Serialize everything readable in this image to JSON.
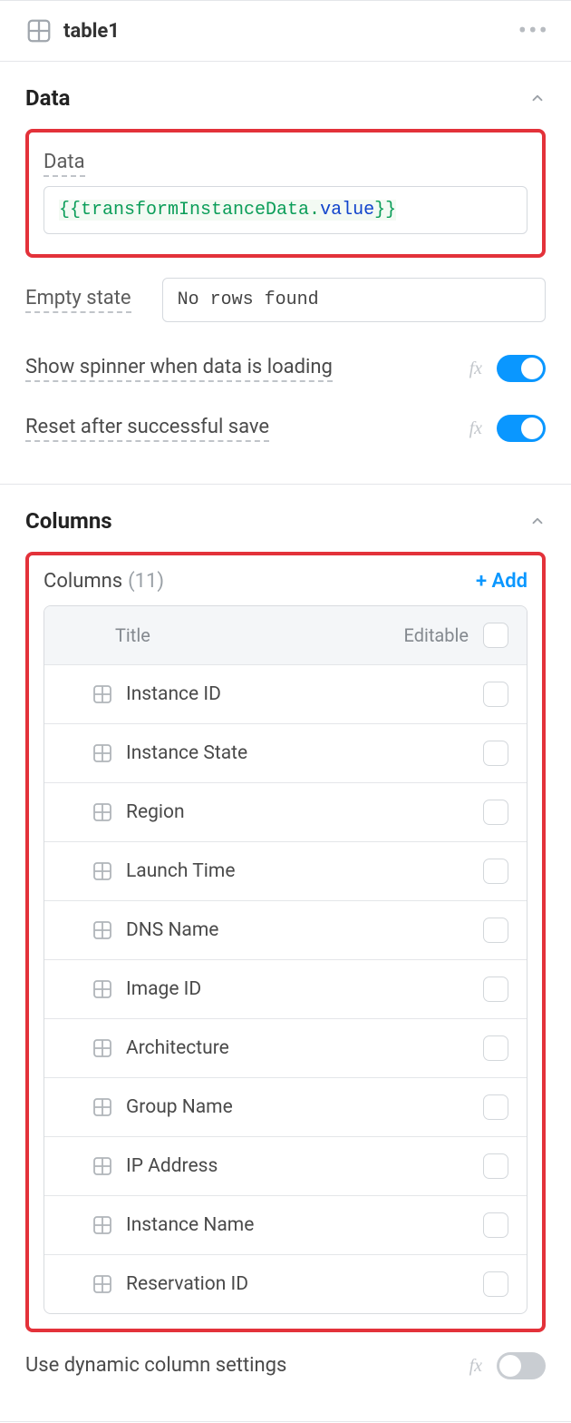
{
  "header": {
    "component_name": "table1"
  },
  "sections": {
    "data": {
      "title": "Data",
      "data_field_label": "Data",
      "data_expression_open": "{{",
      "data_expression_ident": "transformInstanceData.",
      "data_expression_prop": "value",
      "data_expression_close": "}}",
      "empty_state_label": "Empty state",
      "empty_state_value": "No rows found",
      "spinner_label": "Show spinner when data is loading",
      "spinner_on": true,
      "reset_label": "Reset after successful save",
      "reset_on": true
    },
    "columns": {
      "title": "Columns",
      "list_label": "Columns",
      "count_text": "(11)",
      "add_label": "+ Add",
      "header_title": "Title",
      "header_editable": "Editable",
      "items": [
        {
          "title": "Instance ID",
          "editable": false
        },
        {
          "title": "Instance State",
          "editable": false
        },
        {
          "title": "Region",
          "editable": false
        },
        {
          "title": "Launch Time",
          "editable": false
        },
        {
          "title": "DNS Name",
          "editable": false
        },
        {
          "title": "Image ID",
          "editable": false
        },
        {
          "title": "Architecture",
          "editable": false
        },
        {
          "title": "Group Name",
          "editable": false
        },
        {
          "title": "IP Address",
          "editable": false
        },
        {
          "title": "Instance Name",
          "editable": false
        },
        {
          "title": "Reservation ID",
          "editable": false
        }
      ],
      "dynamic_label": "Use dynamic column settings",
      "dynamic_on": false
    }
  },
  "fx_label": "fx"
}
